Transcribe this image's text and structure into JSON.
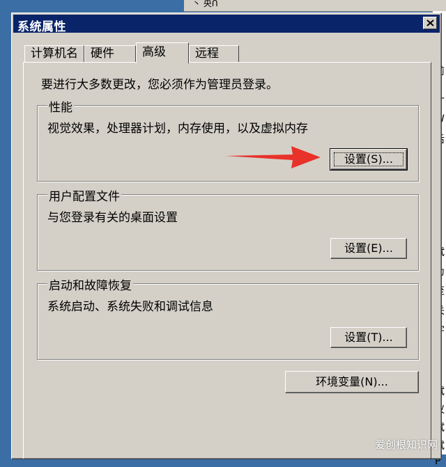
{
  "background": {
    "top_title_fragment": "丶 央ᑎ",
    "right_fragments": [
      "前",
      "十",
      "W",
      "后",
      "S",
      "试",
      "为",
      "至",
      "关",
      "字",
      "D",
      "试",
      "议",
      "试",
      "试",
      "P"
    ]
  },
  "dialog": {
    "title": "系统属性",
    "tabs": [
      "计算机名",
      "硬件",
      "高级",
      "远程"
    ],
    "active_tab": "高级",
    "admin_note": "要进行大多数更改，您必须作为管理员登录。",
    "groups": {
      "performance": {
        "label": "性能",
        "desc": "视觉效果，处理器计划，内存使用，以及虚拟内存",
        "button": "设置(S)..."
      },
      "user_profiles": {
        "label": "用户配置文件",
        "desc": "与您登录有关的桌面设置",
        "button": "设置(E)..."
      },
      "startup_recovery": {
        "label": "启动和故障恢复",
        "desc": "系统启动、系统失败和调试信息",
        "button": "设置(T)..."
      }
    },
    "env_button": "环境变量(N)..."
  },
  "colors": {
    "titlebar": "#0a246a",
    "face": "#d4d0c8",
    "arrow": "#e8322a"
  },
  "watermark": "爱创根知识网"
}
